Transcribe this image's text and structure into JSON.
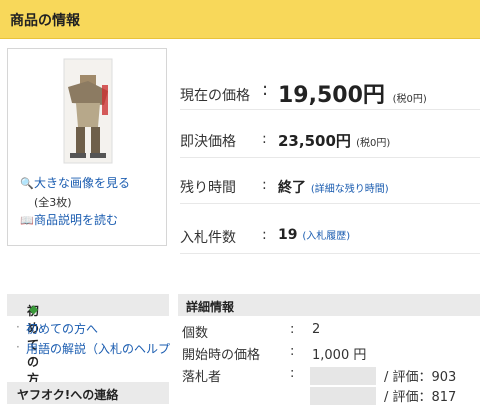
{
  "header": {
    "title": "商品の情報"
  },
  "image_panel": {
    "view_large": "大きな画像を見る",
    "total": "(全3枚)",
    "read_description": "商品説明を読む"
  },
  "price": {
    "current_label": "現在の価格",
    "current_value": "19,500円",
    "current_tax": "(税0円)",
    "buyout_label": "即決価格",
    "buyout_value": "23,500円",
    "buyout_tax": "(税0円)",
    "remaining_label": "残り時間",
    "remaining_value": "終了",
    "remaining_link": "(詳細な残り時間)",
    "bids_label": "入札件数",
    "bids_value": "19",
    "bids_link": "(入札履歴)"
  },
  "sidebar": {
    "beginner_title": "初めての方",
    "items": [
      "初めての方へ",
      "用語の解説（入札のヘルプ"
    ],
    "contact_title": "ヤフオク!への連絡"
  },
  "details": {
    "heading": "詳細情報",
    "rows": [
      {
        "label": "個数",
        "colon": ":",
        "value": "2"
      },
      {
        "label": "開始時の価格",
        "colon": ":",
        "value": "1,000 円"
      },
      {
        "label": "落札者",
        "colon": ":",
        "rating": "/ 評価：903"
      },
      {
        "label": "",
        "colon": "",
        "rating": "/ 評価：817"
      }
    ]
  },
  "colors": {
    "header_bg": "#f8d85a",
    "link": "#1a5cb0",
    "section_bg": "#eaeaea"
  }
}
